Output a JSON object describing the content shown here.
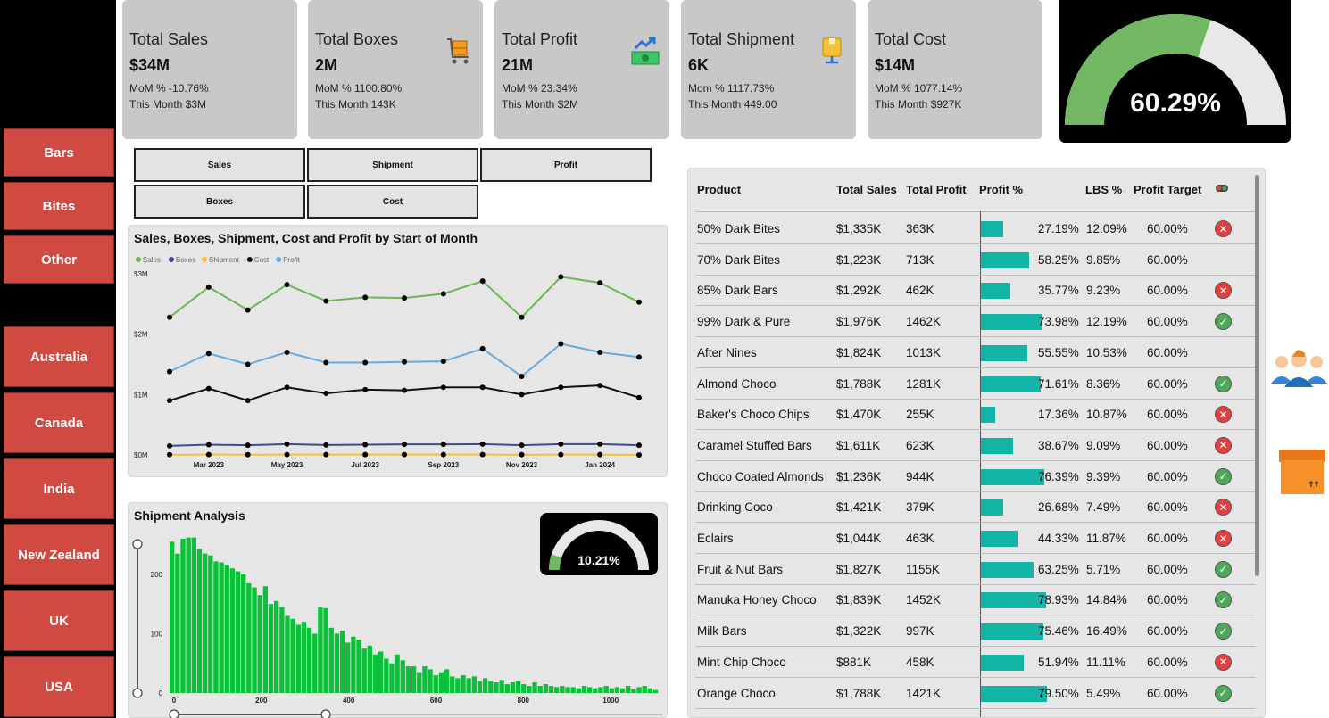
{
  "sidebar": {
    "categories": [
      "Bars",
      "Bites",
      "Other"
    ],
    "countries": [
      "Australia",
      "Canada",
      "India",
      "New Zealand",
      "UK",
      "USA"
    ]
  },
  "kpis": [
    {
      "title": "Total Sales",
      "value": "$34M",
      "line1": "MoM % -10.76%",
      "line2": "This Month $3M",
      "icon": "none"
    },
    {
      "title": "Total Boxes",
      "value": "2M",
      "line1": "MoM % 1100.80%",
      "line2": "This Month 143K",
      "icon": "box-cart-icon"
    },
    {
      "title": "Total Profit",
      "value": "21M",
      "line1": "MoM % 23.34%",
      "line2": "This Month $2M",
      "icon": "money-growth-icon"
    },
    {
      "title": "Total Shipment",
      "value": "6K",
      "line1": "Mom % 1117.73%",
      "line2": "This Month 449.00",
      "icon": "package-icon"
    },
    {
      "title": "Total Cost",
      "value": "$14M",
      "line1": "MoM % 1077.14%",
      "line2": "This Month $927K",
      "icon": "none"
    }
  ],
  "gauge_main": {
    "label": "60.29%",
    "fraction": 0.6029,
    "fill": "#72b862",
    "track": "#e8e8e8"
  },
  "measure_buttons": [
    "Sales",
    "Shipment",
    "Profit",
    "Boxes",
    "Cost"
  ],
  "line_chart": {
    "title": "Sales, Boxes, Shipment, Cost and Profit by Start of Month",
    "legend": [
      "Sales",
      "Boxes",
      "Shipment",
      "Cost",
      "Profit"
    ],
    "y_ticks": [
      "$3M",
      "$2M",
      "$1M",
      "$0M"
    ],
    "x_ticks": [
      "Mar 2023",
      "May 2023",
      "Jul 2023",
      "Sep 2023",
      "Nov 2023",
      "Jan 2024"
    ]
  },
  "shipment": {
    "title": "Shipment Analysis",
    "gauge_label": "10.21%",
    "gauge_fraction": 0.1021,
    "y_ticks": [
      "200",
      "100",
      "0"
    ],
    "x_ticks": [
      "0",
      "200",
      "400",
      "600",
      "800",
      "1000"
    ]
  },
  "table": {
    "headers": [
      "Product",
      "Total Sales",
      "Total Profit",
      "Profit %",
      "LBS %",
      "Profit Target"
    ],
    "rows": [
      {
        "product": "50% Dark Bites",
        "sales": "$1,335K",
        "profit": "363K",
        "pct": "27.19%",
        "lbs": "12.09%",
        "target": "60.00%",
        "status": "bad"
      },
      {
        "product": "70% Dark Bites",
        "sales": "$1,223K",
        "profit": "713K",
        "pct": "58.25%",
        "lbs": "9.85%",
        "target": "60.00%",
        "status": "none"
      },
      {
        "product": "85% Dark Bars",
        "sales": "$1,292K",
        "profit": "462K",
        "pct": "35.77%",
        "lbs": "9.23%",
        "target": "60.00%",
        "status": "bad"
      },
      {
        "product": "99% Dark & Pure",
        "sales": "$1,976K",
        "profit": "1462K",
        "pct": "73.98%",
        "lbs": "12.19%",
        "target": "60.00%",
        "status": "good"
      },
      {
        "product": "After Nines",
        "sales": "$1,824K",
        "profit": "1013K",
        "pct": "55.55%",
        "lbs": "10.53%",
        "target": "60.00%",
        "status": "none"
      },
      {
        "product": "Almond Choco",
        "sales": "$1,788K",
        "profit": "1281K",
        "pct": "71.61%",
        "lbs": "8.36%",
        "target": "60.00%",
        "status": "good"
      },
      {
        "product": "Baker's Choco Chips",
        "sales": "$1,470K",
        "profit": "255K",
        "pct": "17.36%",
        "lbs": "10.87%",
        "target": "60.00%",
        "status": "bad"
      },
      {
        "product": "Caramel Stuffed Bars",
        "sales": "$1,611K",
        "profit": "623K",
        "pct": "38.67%",
        "lbs": "9.09%",
        "target": "60.00%",
        "status": "bad"
      },
      {
        "product": "Choco Coated Almonds",
        "sales": "$1,236K",
        "profit": "944K",
        "pct": "76.39%",
        "lbs": "9.39%",
        "target": "60.00%",
        "status": "good"
      },
      {
        "product": "Drinking Coco",
        "sales": "$1,421K",
        "profit": "379K",
        "pct": "26.68%",
        "lbs": "7.49%",
        "target": "60.00%",
        "status": "bad"
      },
      {
        "product": "Eclairs",
        "sales": "$1,044K",
        "profit": "463K",
        "pct": "44.33%",
        "lbs": "11.87%",
        "target": "60.00%",
        "status": "bad"
      },
      {
        "product": "Fruit & Nut Bars",
        "sales": "$1,827K",
        "profit": "1155K",
        "pct": "63.25%",
        "lbs": "5.71%",
        "target": "60.00%",
        "status": "good"
      },
      {
        "product": "Manuka Honey Choco",
        "sales": "$1,839K",
        "profit": "1452K",
        "pct": "78.93%",
        "lbs": "14.84%",
        "target": "60.00%",
        "status": "good"
      },
      {
        "product": "Milk Bars",
        "sales": "$1,322K",
        "profit": "997K",
        "pct": "75.46%",
        "lbs": "16.49%",
        "target": "60.00%",
        "status": "good"
      },
      {
        "product": "Mint Chip Choco",
        "sales": "$881K",
        "profit": "458K",
        "pct": "51.94%",
        "lbs": "11.11%",
        "target": "60.00%",
        "status": "bad"
      },
      {
        "product": "Orange Choco",
        "sales": "$1,788K",
        "profit": "1421K",
        "pct": "79.50%",
        "lbs": "5.49%",
        "target": "60.00%",
        "status": "good"
      }
    ]
  },
  "chart_data": [
    {
      "type": "line",
      "title": "Sales, Boxes, Shipment, Cost and Profit by Start of Month",
      "x": [
        "Feb 2023",
        "Mar 2023",
        "Apr 2023",
        "May 2023",
        "Jun 2023",
        "Jul 2023",
        "Aug 2023",
        "Sep 2023",
        "Oct 2023",
        "Nov 2023",
        "Dec 2023",
        "Jan 2024",
        "Feb 2024"
      ],
      "ylim": [
        0,
        3000000
      ],
      "series": [
        {
          "name": "Sales",
          "color": "#6fb555",
          "values": [
            2280000,
            2780000,
            2400000,
            2820000,
            2550000,
            2610000,
            2600000,
            2670000,
            2880000,
            2280000,
            2950000,
            2850000,
            2530000
          ]
        },
        {
          "name": "Boxes",
          "color": "#3b4d8c",
          "values": [
            150000,
            170000,
            160000,
            180000,
            165000,
            170000,
            175000,
            175000,
            180000,
            160000,
            180000,
            180000,
            160000
          ]
        },
        {
          "name": "Shipment",
          "color": "#f2c230",
          "values": [
            4000,
            5000,
            4500,
            5000,
            4800,
            4900,
            4900,
            5000,
            5100,
            4600,
            5200,
            5100,
            449
          ]
        },
        {
          "name": "Cost",
          "color": "#111111",
          "values": [
            900000,
            1100000,
            900000,
            1120000,
            1020000,
            1080000,
            1070000,
            1120000,
            1120000,
            1000000,
            1120000,
            1150000,
            950000
          ]
        },
        {
          "name": "Profit",
          "color": "#6aa9de",
          "values": [
            1380000,
            1680000,
            1500000,
            1700000,
            1530000,
            1530000,
            1540000,
            1550000,
            1760000,
            1300000,
            1840000,
            1700000,
            1620000
          ]
        }
      ]
    },
    {
      "type": "bar",
      "title": "Shipment Analysis",
      "xlim": [
        0,
        1110
      ],
      "ylim": [
        0,
        260
      ],
      "color": "#0bc13a",
      "values": [
        255,
        235,
        260,
        262,
        262,
        243,
        235,
        232,
        222,
        220,
        215,
        210,
        205,
        200,
        185,
        178,
        165,
        180,
        150,
        155,
        145,
        130,
        125,
        115,
        120,
        110,
        100,
        145,
        143,
        110,
        100,
        105,
        85,
        95,
        90,
        75,
        80,
        65,
        70,
        58,
        50,
        65,
        55,
        45,
        45,
        35,
        45,
        40,
        30,
        35,
        40,
        28,
        25,
        30,
        25,
        28,
        20,
        25,
        20,
        18,
        22,
        15,
        18,
        20,
        15,
        12,
        18,
        12,
        15,
        12,
        10,
        12,
        10,
        10,
        8,
        12,
        10,
        8,
        10,
        12,
        8,
        10,
        8,
        12,
        6,
        10,
        12,
        8,
        5
      ]
    }
  ]
}
